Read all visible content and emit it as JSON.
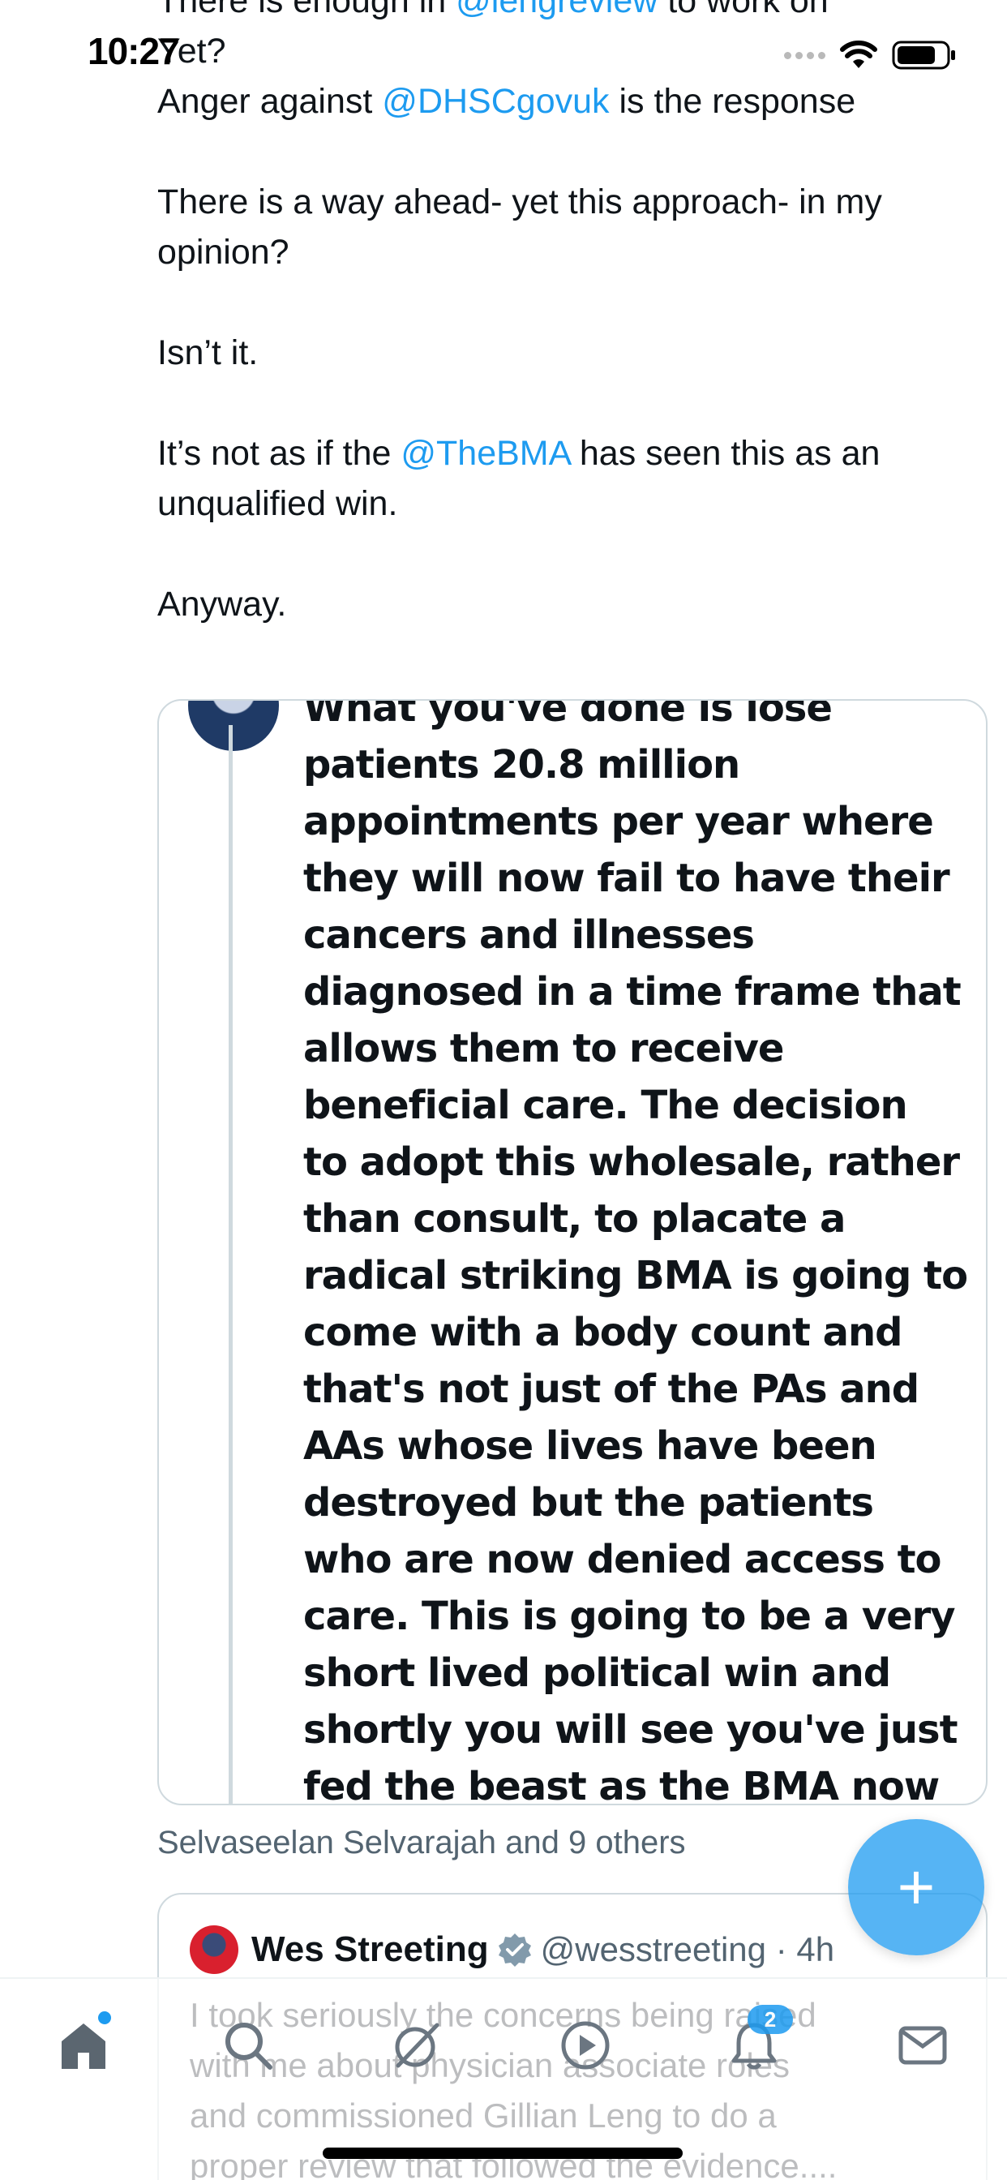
{
  "status_bar": {
    "time": "10:27"
  },
  "tweet": {
    "lines": [
      [
        {
          "t": "There is enough in "
        },
        {
          "t": "@lengreview",
          "mention": true
        },
        {
          "t": " to work on"
        }
      ],
      [
        {
          "t": "Yet?"
        }
      ],
      [
        {
          "t": "Anger against "
        },
        {
          "t": "@DHSCgovuk",
          "mention": true
        },
        {
          "t": " is the response"
        }
      ],
      [],
      [
        {
          "t": "There is a way ahead- yet this approach- in my"
        }
      ],
      [
        {
          "t": "opinion?"
        }
      ],
      [],
      [
        {
          "t": "Isn’t it."
        }
      ],
      [],
      [
        {
          "t": "It’s not as if the "
        },
        {
          "t": "@TheBMA",
          "mention": true
        },
        {
          "t": " has seen this as an"
        }
      ],
      [
        {
          "t": "unqualified win."
        }
      ],
      [],
      [
        {
          "t": "Anyway."
        }
      ]
    ]
  },
  "quoted_tweet": {
    "lines": [
      "What you've done is lose",
      "patients 20.8 million",
      "appointments per year where",
      "they will now fail to have their",
      "cancers and illnesses",
      "diagnosed in a time frame that",
      "allows them to receive",
      "beneficial care. The decision",
      "to adopt this wholesale, rather",
      "than consult, to placate a",
      "radical striking BMA is going to",
      "come with a body count and",
      "that's not just of the PAs and",
      "AAs whose lives have been",
      "destroyed but the patients",
      "who are now denied access to",
      "care. This is going to be a very",
      "short lived political win and",
      "shortly you will see you've just",
      "fed the beast as the BMA now"
    ]
  },
  "liked_by": "Selvaseelan Selvarajah and 9 others",
  "fab": {
    "label": "+"
  },
  "second_tweet": {
    "name": "Wes Streeting",
    "handle": "@wesstreeting · 4h",
    "verified": true,
    "lines": [
      "I took seriously the concerns being raised",
      "with me about physician associate roles",
      "and commissioned Gillian Leng to do a",
      "proper review that followed the evidence...."
    ]
  },
  "nav": {
    "items": [
      {
        "name": "home",
        "icon": "home-icon",
        "active": true,
        "dot": true
      },
      {
        "name": "search",
        "icon": "search-icon"
      },
      {
        "name": "grok",
        "icon": "grok-icon"
      },
      {
        "name": "videos",
        "icon": "play-icon"
      },
      {
        "name": "notifications",
        "icon": "bell-icon",
        "badge": "2"
      },
      {
        "name": "messages",
        "icon": "mail-icon"
      }
    ]
  },
  "colors": {
    "accent": "#1d9bf0",
    "text": "#0f1419",
    "secondary": "#536471",
    "border": "#cfd9de"
  }
}
